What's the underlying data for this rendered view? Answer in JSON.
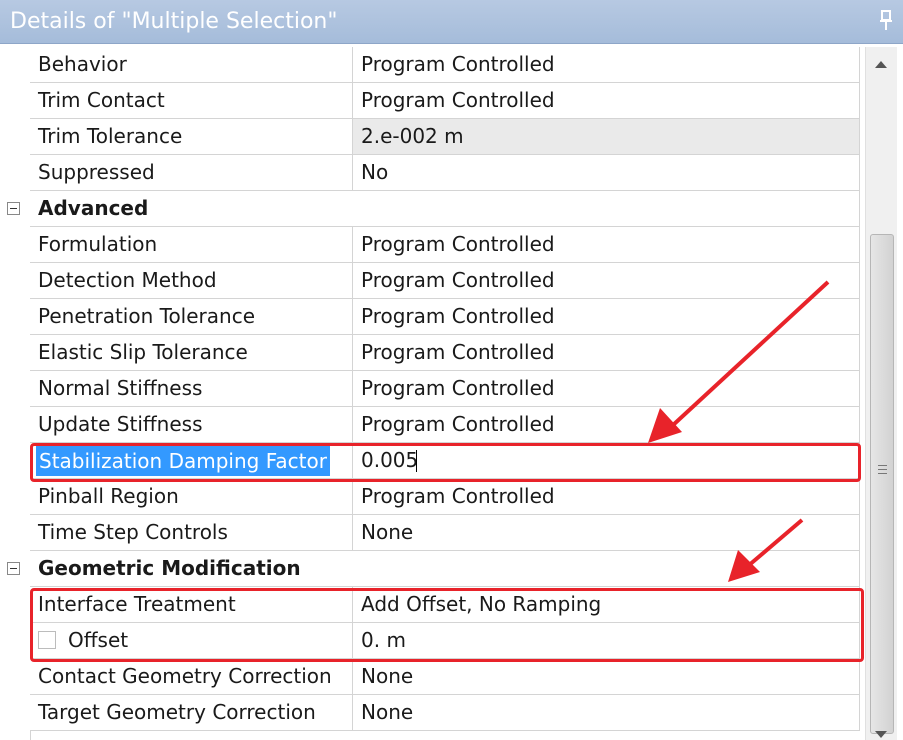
{
  "window": {
    "title": "Details of \"Multiple Selection\""
  },
  "rows": [
    {
      "kind": "prop",
      "name": "Behavior",
      "value": "Program Controlled"
    },
    {
      "kind": "prop",
      "name": "Trim Contact",
      "value": "Program Controlled"
    },
    {
      "kind": "prop",
      "name": "Trim Tolerance",
      "value": "2.e-002 m",
      "readonly": true
    },
    {
      "kind": "prop",
      "name": "Suppressed",
      "value": "No"
    },
    {
      "kind": "group",
      "name": "Advanced"
    },
    {
      "kind": "prop",
      "name": "Formulation",
      "value": "Program Controlled"
    },
    {
      "kind": "prop",
      "name": "Detection Method",
      "value": "Program Controlled"
    },
    {
      "kind": "prop",
      "name": "Penetration Tolerance",
      "value": "Program Controlled"
    },
    {
      "kind": "prop",
      "name": "Elastic Slip Tolerance",
      "value": "Program Controlled"
    },
    {
      "kind": "prop",
      "name": "Normal Stiffness",
      "value": "Program Controlled"
    },
    {
      "kind": "prop",
      "name": "Update Stiffness",
      "value": "Program Controlled"
    },
    {
      "kind": "prop",
      "name": "Stabilization Damping Factor",
      "value": "0.005",
      "selected": true,
      "editing": true
    },
    {
      "kind": "prop",
      "name": "Pinball Region",
      "value": "Program Controlled"
    },
    {
      "kind": "prop",
      "name": "Time Step Controls",
      "value": "None"
    },
    {
      "kind": "group",
      "name": "Geometric Modification"
    },
    {
      "kind": "prop",
      "name": "Interface Treatment",
      "value": "Add Offset, No Ramping"
    },
    {
      "kind": "prop",
      "name": "Offset",
      "value": "0. m",
      "checkbox": true,
      "checked": false
    },
    {
      "kind": "prop",
      "name": "Contact Geometry Correction",
      "value": "None"
    },
    {
      "kind": "prop",
      "name": "Target Geometry Correction",
      "value": "None"
    }
  ],
  "icons": {
    "pin": "pin-icon",
    "collapse": "collapse-minus-icon",
    "scroll_up": "scroll-up-arrow-icon",
    "scroll_down": "scroll-down-arrow-icon"
  },
  "colors": {
    "annotation": "#e8232a",
    "selection": "#3399ff",
    "titlebar": "#a9bfdc"
  }
}
